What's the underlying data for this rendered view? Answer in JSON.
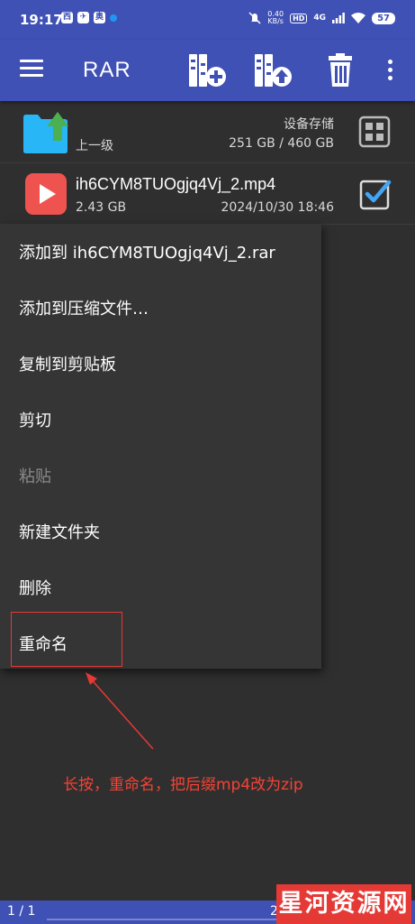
{
  "status_bar": {
    "time": "19:17",
    "app_icons": [
      "西",
      "✈",
      "奥"
    ],
    "net_speed_value": "0.40",
    "net_speed_unit": "KB/s",
    "hd": "HD",
    "signal": "4G",
    "battery": "57"
  },
  "app_bar": {
    "title": "RAR",
    "icons": [
      "menu-icon",
      "archive-add-icon",
      "archive-extract-icon",
      "delete-icon",
      "more-vert-icon"
    ],
    "accent": "#3f51b5"
  },
  "files": {
    "parent": {
      "label": "上一级",
      "storage_label": "设备存储",
      "storage_size": "251 GB / 460 GB"
    },
    "item": {
      "name": "ih6CYM8TUOgjq4Vj_2.mp4",
      "size": "2.43 GB",
      "date": "2024/10/30 18:46",
      "checked": true
    }
  },
  "context_menu": {
    "items": [
      {
        "label": "添加到 ih6CYM8TUOgjq4Vj_2.rar",
        "enabled": true
      },
      {
        "label": "添加到压缩文件…",
        "enabled": true
      },
      {
        "label": "复制到剪贴板",
        "enabled": true
      },
      {
        "label": "剪切",
        "enabled": true
      },
      {
        "label": "粘贴",
        "enabled": false
      },
      {
        "label": "新建文件夹",
        "enabled": true
      },
      {
        "label": "删除",
        "enabled": true
      },
      {
        "label": "重命名",
        "enabled": true
      }
    ]
  },
  "annotation": {
    "text": "长按，重命名，把后缀mp4改为zip",
    "color": "#f44336"
  },
  "bottom": {
    "page": "1 / 1",
    "num": "2"
  },
  "watermark": "星河资源网"
}
